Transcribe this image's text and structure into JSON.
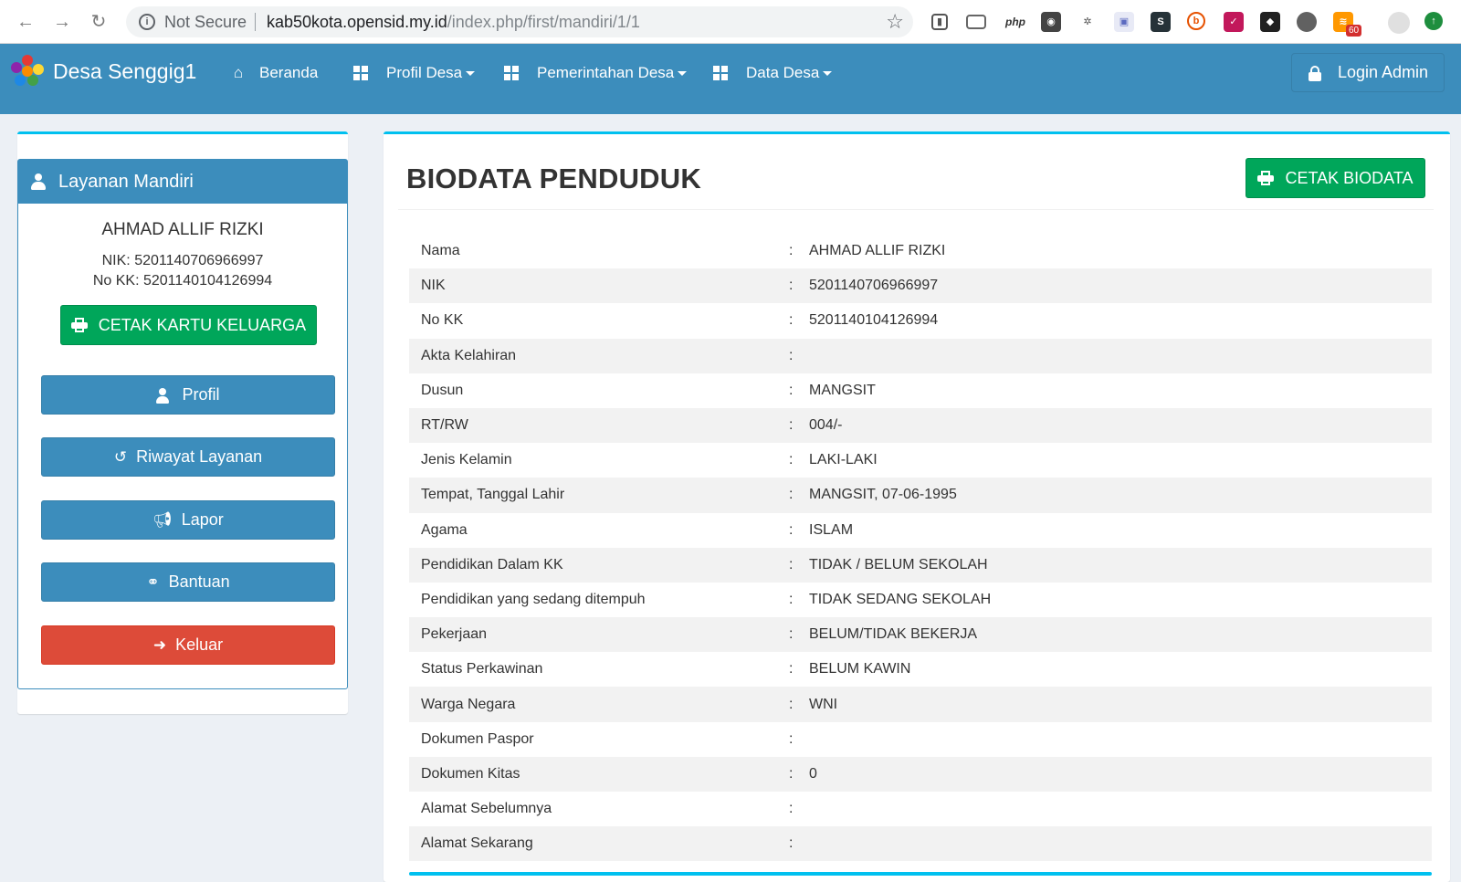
{
  "browser": {
    "security_label": "Not Secure",
    "url_host": "kab50kota.opensid.my.id",
    "url_path": "/index.php/first/mandiri/1/1",
    "extensions": [
      "kanban-icon",
      "screen-icon",
      "php",
      "bulb-icon",
      "leaf-icon",
      "shield-icon",
      "s-icon",
      "b-icon",
      "flag-icon",
      "puzzle-icon",
      "circle-icon",
      "rss-icon"
    ],
    "rss_badge": "60"
  },
  "navbar": {
    "brand": "Desa Senggig1",
    "menu": [
      {
        "label": "Beranda",
        "icon": "home-icon"
      },
      {
        "label": "Profil Desa",
        "icon": "grid-icon"
      },
      {
        "label": "Pemerintahan Desa",
        "icon": "grid-icon"
      },
      {
        "label": "Data Desa",
        "icon": "grid-icon"
      }
    ],
    "login_label": "Login Admin"
  },
  "sidebar": {
    "panel_title": "Layanan Mandiri",
    "user_name": "AHMAD ALLIF RIZKI",
    "nik_line": "NIK: 5201140706966997",
    "kk_line": "No KK: 5201140104126994",
    "print_kk_label": "CETAK KARTU KELUARGA",
    "buttons": [
      {
        "label": "Profil",
        "icon": "user-icon"
      },
      {
        "label": "Riwayat Layanan",
        "icon": "history-icon"
      },
      {
        "label": "Lapor",
        "icon": "bullhorn-icon"
      },
      {
        "label": "Bantuan",
        "icon": "handshake-icon"
      },
      {
        "label": "Keluar",
        "icon": "sign-out-icon"
      }
    ]
  },
  "main": {
    "title": "BIODATA PENDUDUK",
    "print_label": "CETAK BIODATA",
    "colon": ":",
    "rows": [
      {
        "label": "Nama",
        "value": "AHMAD ALLIF RIZKI"
      },
      {
        "label": "NIK",
        "value": "5201140706966997"
      },
      {
        "label": "No KK",
        "value": "5201140104126994"
      },
      {
        "label": "Akta Kelahiran",
        "value": ""
      },
      {
        "label": "Dusun",
        "value": "MANGSIT"
      },
      {
        "label": "RT/RW",
        "value": "004/-"
      },
      {
        "label": "Jenis Kelamin",
        "value": "LAKI-LAKI"
      },
      {
        "label": "Tempat, Tanggal Lahir",
        "value": "MANGSIT, 07-06-1995"
      },
      {
        "label": "Agama",
        "value": "ISLAM"
      },
      {
        "label": "Pendidikan Dalam KK",
        "value": "TIDAK / BELUM SEKOLAH"
      },
      {
        "label": "Pendidikan yang sedang ditempuh",
        "value": "TIDAK SEDANG SEKOLAH"
      },
      {
        "label": "Pekerjaan",
        "value": "BELUM/TIDAK BEKERJA"
      },
      {
        "label": "Status Perkawinan",
        "value": "BELUM KAWIN"
      },
      {
        "label": "Warga Negara",
        "value": "WNI"
      },
      {
        "label": "Dokumen Paspor",
        "value": ""
      },
      {
        "label": "Dokumen Kitas",
        "value": "0"
      },
      {
        "label": "Alamat Sebelumnya",
        "value": ""
      },
      {
        "label": "Alamat Sekarang",
        "value": ""
      }
    ]
  },
  "colors": {
    "navbar": "#3c8dbc",
    "accent": "#00c0ef",
    "success": "#00a65a",
    "danger": "#dd4b39"
  }
}
